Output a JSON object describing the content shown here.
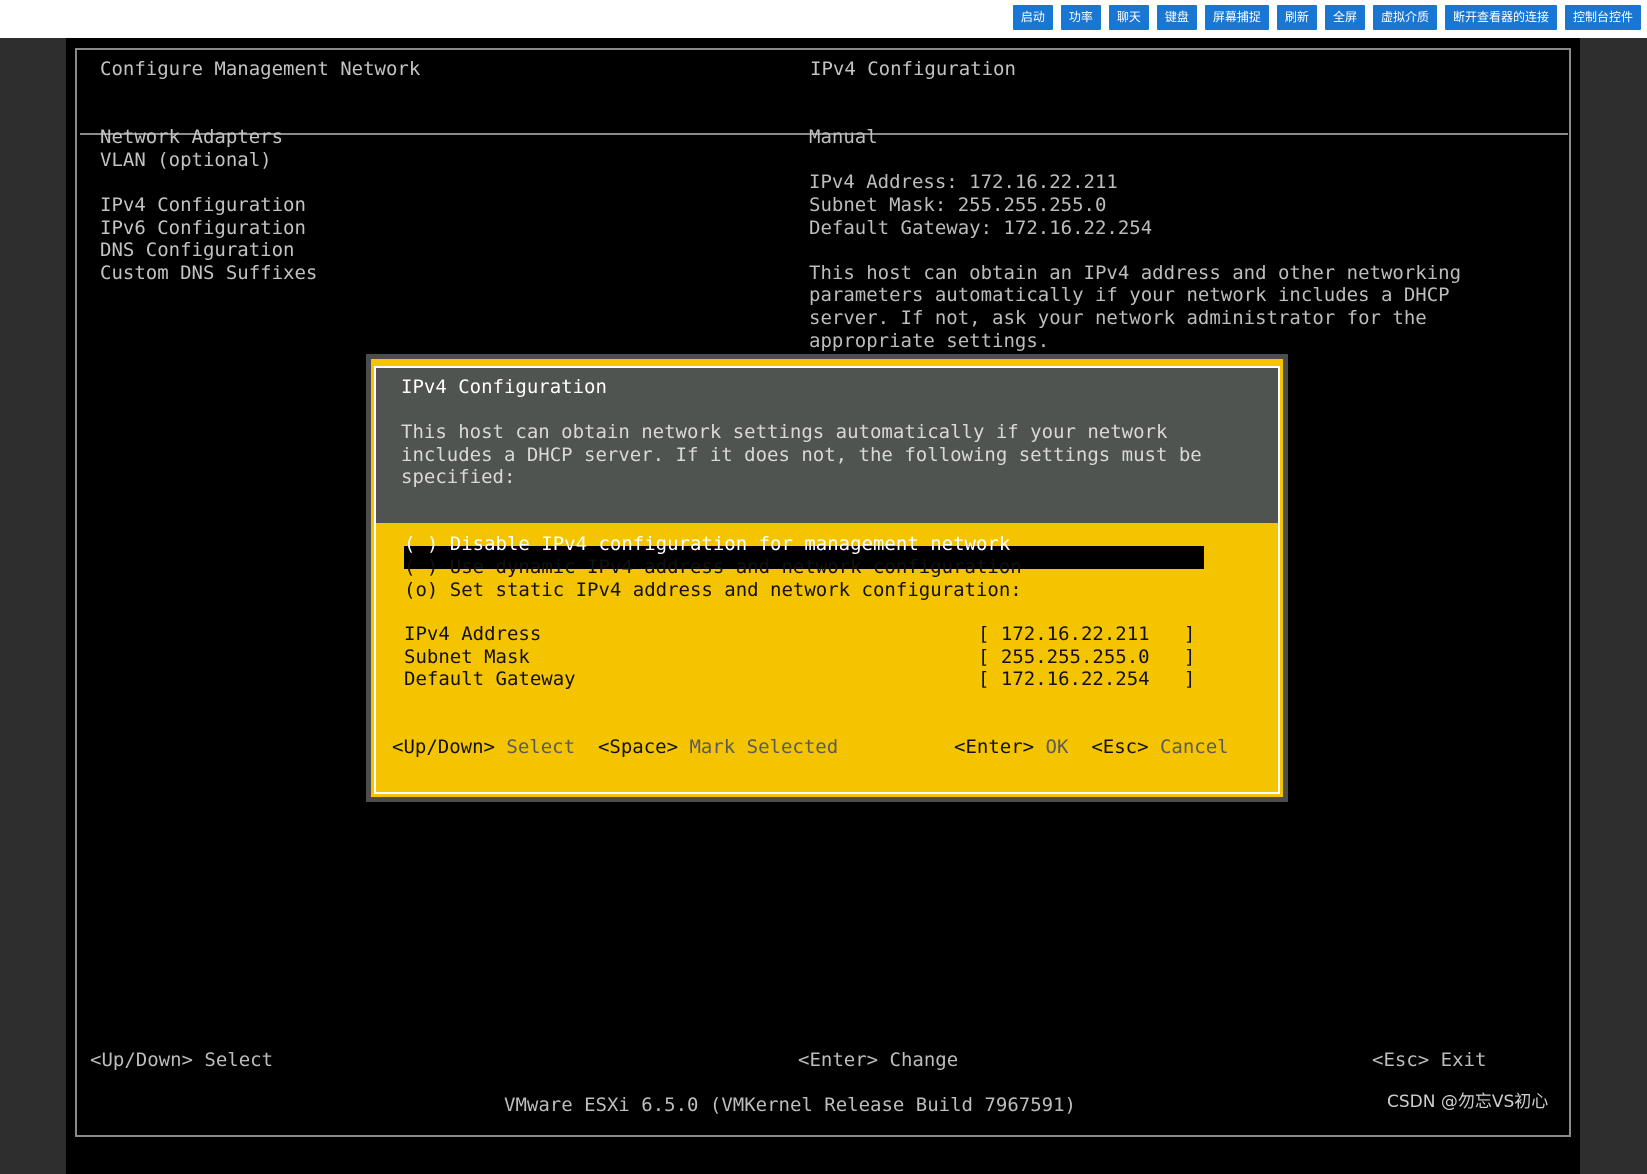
{
  "toolbar": {
    "buttons": [
      "启动",
      "功率",
      "聊天",
      "键盘",
      "屏幕捕捉",
      "刷新",
      "全屏",
      "虚拟介质",
      "断开查看器的连接",
      "控制台控件"
    ],
    "accent": "#1976d2"
  },
  "header": {
    "left_title": "Configure Management Network",
    "right_title": "IPv4 Configuration"
  },
  "menu": {
    "items": [
      "Network Adapters",
      "VLAN (optional)",
      "IPv4 Configuration",
      "IPv6 Configuration",
      "DNS Configuration",
      "Custom DNS Suffixes"
    ]
  },
  "info": {
    "mode": "Manual",
    "address_line": "IPv4 Address: 172.16.22.211",
    "mask_line": "Subnet Mask: 255.255.255.0",
    "gateway_line": "Default Gateway: 172.16.22.254",
    "description": [
      "This host can obtain an IPv4 address and other networking",
      "parameters automatically if your network includes a DHCP",
      "server. If not, ask your network administrator for the",
      "appropriate settings."
    ]
  },
  "dialog": {
    "title": "IPv4 Configuration",
    "description": [
      "This host can obtain network settings automatically if your network",
      "includes a DHCP server. If it does not, the following settings must be",
      "specified:"
    ],
    "options": [
      "( ) Disable IPv4 configuration for management network",
      "( ) Use dynamic IPv4 address and network configuration",
      "(o) Set static IPv4 address and network configuration:"
    ],
    "fields": [
      {
        "label": "IPv4 Address",
        "value": "[ 172.16.22.211   ]"
      },
      {
        "label": "Subnet Mask",
        "value": "[ 255.255.255.0   ]"
      },
      {
        "label": "Default Gateway",
        "value": "[ 172.16.22.254   ]"
      }
    ],
    "keys": {
      "updown_key": "<Up/Down>",
      "updown_desc": "Select",
      "space_key": "<Space>",
      "space_desc": "Mark Selected",
      "enter_key": "<Enter>",
      "enter_desc": "OK",
      "esc_key": "<Esc>",
      "esc_desc": "Cancel"
    },
    "accent": "#f5c400"
  },
  "footer": {
    "select_hint": "<Up/Down> Select",
    "change_hint": "<Enter> Change",
    "exit_hint": "<Esc> Exit",
    "version": "VMware ESXi 6.5.0 (VMKernel Release Build 7967591)"
  },
  "watermark": "CSDN @勿忘VS初心"
}
